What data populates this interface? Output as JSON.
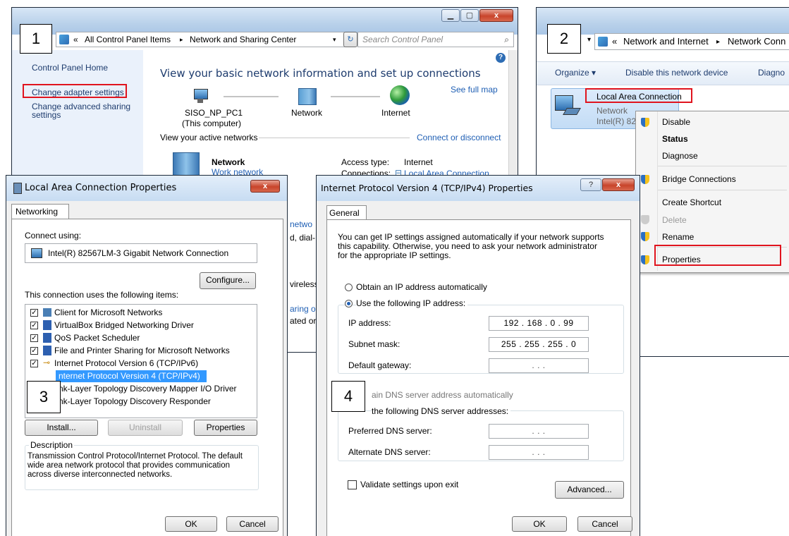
{
  "badges": {
    "b1": "1",
    "b2": "2",
    "b3": "3",
    "b4": "4"
  },
  "nsc": {
    "address_prefix": "«",
    "address_items": "All Control Panel Items",
    "address_sep": "▸",
    "address_current": "Network and Sharing Center",
    "search_placeholder": "Search Control Panel",
    "sidebar": {
      "home": "Control Panel Home",
      "adapter": "Change adapter settings",
      "advanced": "Change advanced sharing\nsettings"
    },
    "heading": "View your basic network information and set up connections",
    "see_full_map": "See full map",
    "node_pc": "SISO_NP_PC1",
    "node_pc_sub": "(This computer)",
    "node_network": "Network",
    "node_internet": "Internet",
    "active_networks": "View your active networks",
    "connect_disconnect": "Connect or disconnect",
    "network_name": "Network",
    "network_type": "Work network",
    "access_type_label": "Access type:",
    "access_type_value": "Internet",
    "connections_label": "Connections:",
    "connections_value": "Local Area Connection",
    "partial1": "netwo",
    "partial2": "d, dial-",
    "partial3": "vireless",
    "partial4": "aring o",
    "partial5": "ated or"
  },
  "netconn": {
    "address_prefix": "«",
    "address_a": "Network and Internet",
    "address_sep": "▸",
    "address_b": "Network Conn",
    "toolbar": {
      "organize": "Organize ▾",
      "disable": "Disable this network device",
      "diagnose": "Diagno"
    },
    "adapter_name": "Local Area Connection",
    "adapter_status": "Network",
    "adapter_device": "Intel(R) 82",
    "menu": [
      "Disable",
      "Status",
      "Diagnose",
      "Bridge Connections",
      "Create Shortcut",
      "Delete",
      "Rename",
      "Properties"
    ]
  },
  "lacp": {
    "title": "Local Area Connection Properties",
    "tab": "Networking",
    "connect_using": "Connect using:",
    "adapter": "Intel(R) 82567LM-3 Gigabit Network Connection",
    "configure": "Configure...",
    "items_label": "This connection uses the following items:",
    "items": [
      "Client for Microsoft Networks",
      "VirtualBox Bridged Networking Driver",
      "QoS Packet Scheduler",
      "File and Printer Sharing for Microsoft Networks",
      "Internet Protocol Version 6 (TCP/IPv6)",
      "nternet Protocol Version 4 (TCP/IPv4)",
      "nk-Layer Topology Discovery Mapper I/O Driver",
      "nk-Layer Topology Discovery Responder"
    ],
    "install": "Install...",
    "uninstall": "Uninstall",
    "properties": "Properties",
    "description_label": "Description",
    "description": "Transmission Control Protocol/Internet Protocol. The default\nwide area network protocol that provides communication\nacross diverse interconnected networks.",
    "ok": "OK",
    "cancel": "Cancel"
  },
  "ipv4": {
    "title": "Internet Protocol Version 4 (TCP/IPv4) Properties",
    "tab": "General",
    "intro": "You can get IP settings assigned automatically if your network supports\nthis capability. Otherwise, you need to ask your network administrator\nfor the appropriate IP settings.",
    "obtain_auto": "Obtain an IP address automatically",
    "use_following": "Use the following IP address:",
    "ip_label": "IP address:",
    "ip_value": "192 . 168 .  0  . 99",
    "mask_label": "Subnet mask:",
    "mask_value": "255 . 255 . 255 .  0",
    "gateway_label": "Default gateway:",
    "empty_ip": ".      .      .",
    "dns_auto": "ain DNS server address automatically",
    "dns_following": "the following DNS server addresses:",
    "preferred_label": "Preferred DNS server:",
    "alternate_label": "Alternate DNS server:",
    "validate": "Validate settings upon exit",
    "advanced": "Advanced...",
    "ok": "OK",
    "cancel": "Cancel"
  },
  "colors": {
    "highlight": "#e0141e",
    "link": "#1f5fb4",
    "selection": "#3399ff"
  }
}
